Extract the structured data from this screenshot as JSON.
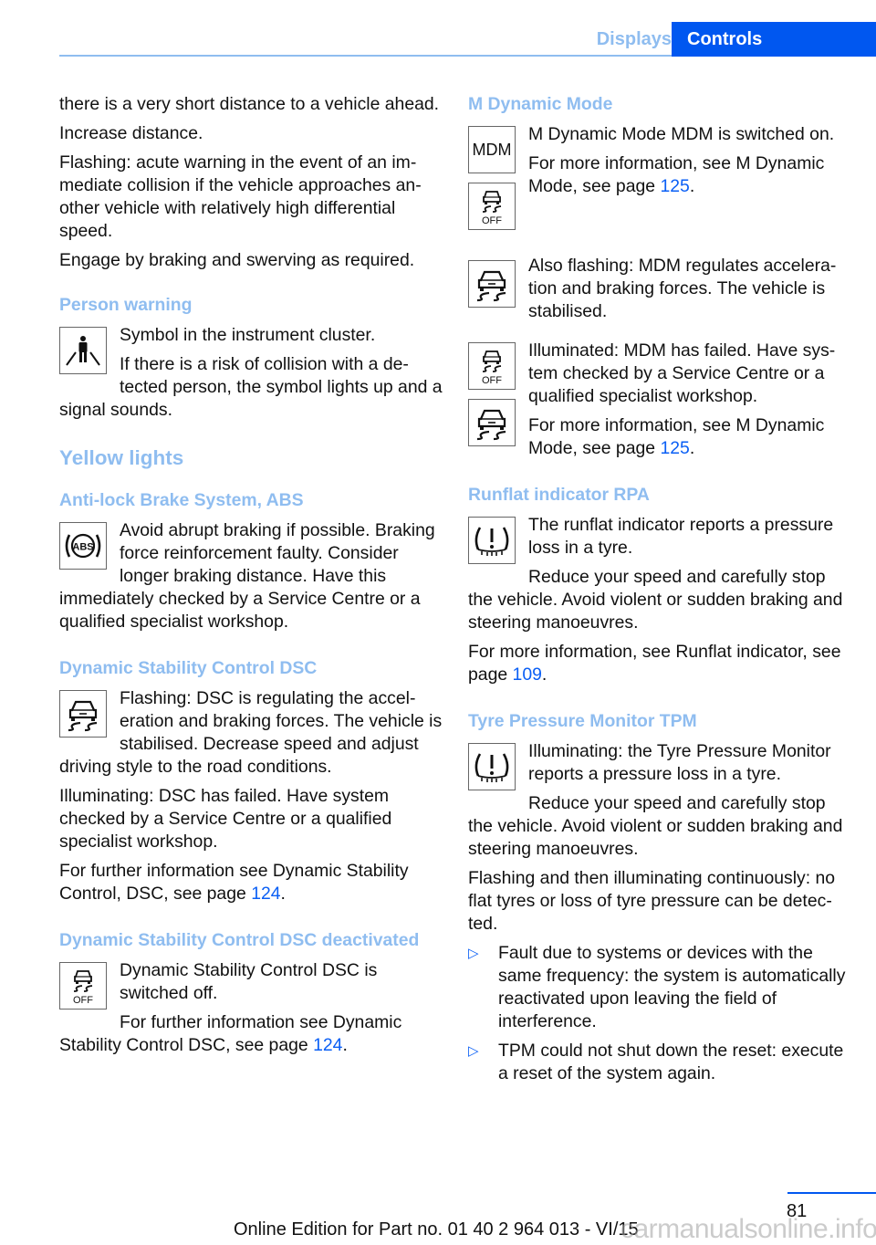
{
  "header": {
    "tabs": [
      {
        "label": "Displays",
        "active": false
      },
      {
        "label": "Controls",
        "active": true
      }
    ]
  },
  "colors": {
    "heading": "#8fbdf0",
    "accent": "#0057f0",
    "link": "#0a5ff5"
  },
  "left": {
    "intro": [
      "there is a very short distance to a vehicle ahead.",
      "Increase distance.",
      "Flashing: acute warning in the event of an im­mediate collision if the vehicle approaches an­other vehicle with relatively high differential speed.",
      "Engage by braking and swerving as required."
    ],
    "person_warning": {
      "title": "Person warning",
      "icon": "person-warning-icon",
      "p1": "Symbol in the instrument cluster.",
      "p2": "If there is a risk of collision with a de­tected person, the symbol lights up and a signal sounds."
    },
    "yellow_lights": "Yellow lights",
    "abs": {
      "title": "Anti-lock Brake System, ABS",
      "icon": "abs-icon",
      "p1": "Avoid abrupt braking if possible. Brak­ing force reinforcement faulty. Con­sider longer braking distance. Have this immediately checked by a Service Centre or a qualified specialist workshop."
    },
    "dsc": {
      "title": "Dynamic Stability Control DSC",
      "icon": "dsc-icon",
      "p1": "Flashing: DSC is regulating the accel­eration and braking forces. The vehicle is stabilised. Decrease speed and ad­just driving style to the road conditions.",
      "p2": "Illuminating: DSC has failed. Have system checked by a Service Centre or a qualified specialist workshop.",
      "p3_pre": "For further information see Dynamic Stability Control, DSC, see page ",
      "p3_link": "124",
      "p3_post": "."
    },
    "dsc_off": {
      "title": "Dynamic Stability Control DSC deactivated",
      "icon": "dsc-off-icon",
      "p1": "Dynamic Stability Control DSC is switched off.",
      "p2_pre": "For further information see Dynamic Stability Control DSC, see page ",
      "p2_link": "124",
      "p2_post": "."
    }
  },
  "right": {
    "mdm": {
      "title": "M Dynamic Mode",
      "icon_label": "MDM",
      "p1": "M Dynamic Mode MDM is switched on.",
      "p2_pre": "For more information, see M Dynamic Mode, see page ",
      "p2_link": "125",
      "p2_post": ".",
      "p3": "Also flashing: MDM regulates accelera­tion and braking forces. The vehicle is stabilised.",
      "p4": "Illuminated: MDM has failed. Have sys­tem checked by a Service Centre or a qualified specialist workshop.",
      "p5_pre": "For more information, see M Dynamic Mode, see page ",
      "p5_link": "125",
      "p5_post": "."
    },
    "rpa": {
      "title": "Runflat indicator RPA",
      "icon": "tyre-pressure-icon",
      "p1": "The runflat indicator reports a pressure loss in a tyre.",
      "p2": "Reduce your speed and carefully stop the vehicle. Avoid violent or sudden braking and steering manoeuvres.",
      "p3_pre": "For more information, see Runflat indicator, see page ",
      "p3_link": "109",
      "p3_post": "."
    },
    "tpm": {
      "title": "Tyre Pressure Monitor TPM",
      "icon": "tyre-pressure-icon",
      "p1": "Illuminating: the Tyre Pressure Monitor reports a pressure loss in a tyre.",
      "p2": "Reduce your speed and carefully stop the vehicle. Avoid violent or sudden braking and steering manoeuvres.",
      "p3": "Flashing and then illuminating continuously: no flat tyres or loss of tyre pressure can be detec­ted.",
      "bullets": [
        "Fault due to systems or devices with the same frequency: the system is automati­cally reactivated upon leaving the field of interference.",
        "TPM could not shut down the reset: exe­cute a reset of the system again."
      ],
      "bullet_glyph": "▷"
    }
  },
  "footer": {
    "page_number": "81",
    "edition": "Online Edition for Part no. 01 40 2 964 013 - VI/15",
    "watermark": "carmanualsonline.info"
  }
}
